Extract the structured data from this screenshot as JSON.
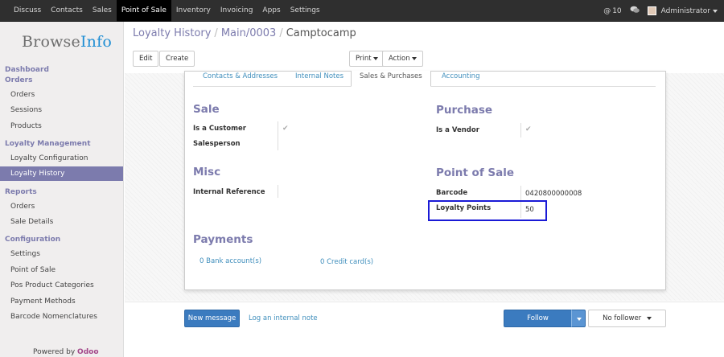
{
  "topnav": {
    "items": [
      "Discuss",
      "Contacts",
      "Sales",
      "Point of Sale",
      "Inventory",
      "Invoicing",
      "Apps",
      "Settings"
    ],
    "active": "Point of Sale",
    "messages_count": "10",
    "user": "Administrator"
  },
  "sidebar": {
    "logo_a": "Browse",
    "logo_b": "Info",
    "sections": {
      "dashboard": "Dashboard",
      "orders": "Orders",
      "loyalty": "Loyalty Management",
      "reports": "Reports",
      "configuration": "Configuration"
    },
    "orders_items": [
      "Orders",
      "Sessions",
      "Products"
    ],
    "loyalty_items": [
      "Loyalty Configuration",
      "Loyalty History"
    ],
    "reports_items": [
      "Orders",
      "Sale Details"
    ],
    "config_items": [
      "Settings",
      "Point of Sale",
      "Pos Product Categories",
      "Payment Methods",
      "Barcode Nomenclatures"
    ],
    "powered_by": "Powered by",
    "odoo": "Odoo"
  },
  "breadcrumb": {
    "first": "Loyalty History",
    "second": "Main/0003",
    "current": "Camptocamp",
    "sep": "/"
  },
  "toolbar": {
    "edit": "Edit",
    "create": "Create",
    "print": "Print",
    "action": "Action"
  },
  "tabs": [
    "Contacts & Addresses",
    "Internal Notes",
    "Sales & Purchases",
    "Accounting"
  ],
  "form": {
    "sale_title": "Sale",
    "is_customer_label": "Is a Customer",
    "salesperson_label": "Salesperson",
    "purchase_title": "Purchase",
    "is_vendor_label": "Is a Vendor",
    "misc_title": "Misc",
    "internal_ref_label": "Internal Reference",
    "pos_title": "Point of Sale",
    "barcode_label": "Barcode",
    "barcode_value": "0420800000008",
    "loyalty_label": "Loyalty Points",
    "loyalty_value": "50",
    "payments_title": "Payments",
    "bank_accounts": "0 Bank account(s)",
    "credit_cards": "0 Credit card(s)"
  },
  "chatter": {
    "new_message": "New message",
    "log_note": "Log an internal note",
    "follow": "Follow",
    "no_follower": "No follower"
  }
}
